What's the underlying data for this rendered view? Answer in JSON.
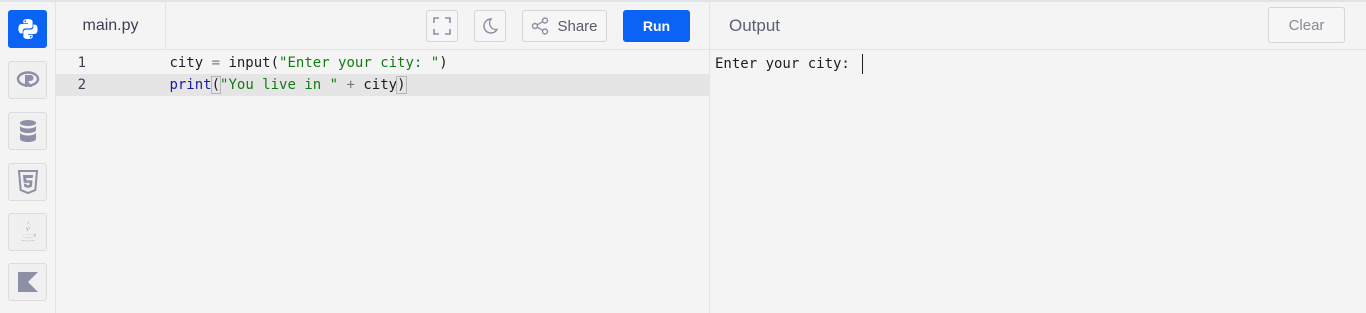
{
  "sidebar": {
    "items": [
      {
        "name": "python-icon",
        "active": true
      },
      {
        "name": "r-icon",
        "active": false
      },
      {
        "name": "database-icon",
        "active": false
      },
      {
        "name": "html5-icon",
        "active": false
      },
      {
        "name": "java-icon",
        "active": false
      },
      {
        "name": "kotlin-icon",
        "active": false
      }
    ]
  },
  "toolbar": {
    "file_tab": "main.py",
    "share_label": "Share",
    "run_label": "Run"
  },
  "editor": {
    "lines": [
      {
        "number": "1",
        "tokens": [
          {
            "t": "city",
            "c": "id"
          },
          {
            "t": " = ",
            "c": "op"
          },
          {
            "t": "input",
            "c": "id"
          },
          {
            "t": "(",
            "c": "id"
          },
          {
            "t": "\"Enter your city: \"",
            "c": "str"
          },
          {
            "t": ")",
            "c": "id"
          }
        ]
      },
      {
        "number": "2",
        "tokens": [
          {
            "t": "print",
            "c": "kw"
          },
          {
            "t": "(",
            "c": "id"
          },
          {
            "t": "\"You live in \"",
            "c": "str"
          },
          {
            "t": " + ",
            "c": "op"
          },
          {
            "t": "city",
            "c": "id"
          },
          {
            "t": ")",
            "c": "id"
          }
        ]
      }
    ]
  },
  "output": {
    "title": "Output",
    "clear_label": "Clear",
    "text": "Enter your city: "
  },
  "colors": {
    "accent": "#0b63f6",
    "string": "#127c12",
    "keyword": "#1a1aa6"
  }
}
